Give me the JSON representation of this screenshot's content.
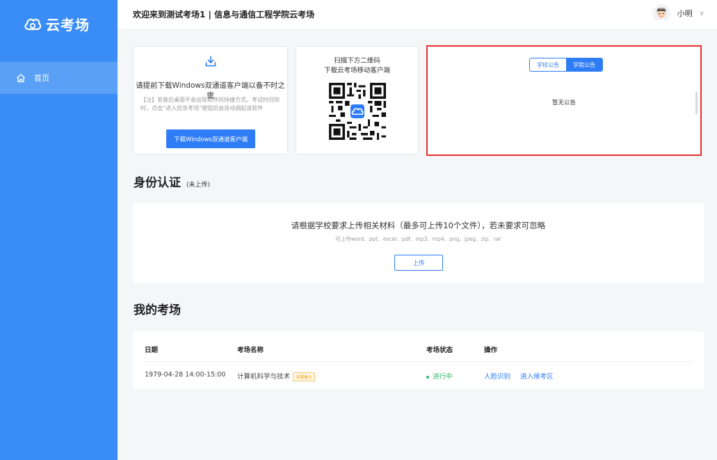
{
  "app": {
    "logo_text": "云考场",
    "colors": {
      "sidebar": "#3a8df6",
      "primary": "#2f7df6",
      "success": "#2fb86a",
      "highlight_border": "#e3302e"
    }
  },
  "sidebar": {
    "items": [
      {
        "label": "首页",
        "icon": "home-icon"
      }
    ]
  },
  "header": {
    "title": "欢迎来到测试考场1 | 信息与通信工程学院云考场",
    "user_name": "小明"
  },
  "download_card": {
    "title": "请提前下载Windows双通道客户端以备不时之需",
    "note": "【注】安装后桌面不会出现软件的快捷方式。考试时间到时，点击“进入应急考场”按钮后会自动调起该软件",
    "button": "下载Windows双通道客户端"
  },
  "qr_card": {
    "line1": "扫描下方二维码",
    "line2": "下载云考场移动客户端"
  },
  "notice_card": {
    "tabs": [
      {
        "label": "学校公告",
        "active": false
      },
      {
        "label": "学院公告",
        "active": true
      }
    ],
    "empty_text": "暂无公告"
  },
  "identity": {
    "title": "身份认证",
    "status": "(未上传)",
    "main_text": "请根据学校要求上传相关材料（最多可上传10个文件），若未要求可忽略",
    "sub_text": "可上传word、ppt、excel、pdf、mp3、mp4、png、jpeg、zip、rar",
    "upload_button": "上传"
  },
  "exams": {
    "title": "我的考场",
    "columns": {
      "date": "日期",
      "name": "考场名称",
      "status": "考场状态",
      "actions": "操作"
    },
    "rows": [
      {
        "date": "1979-04-28 14:00-15:00",
        "name": "计算机科学与技术",
        "badge": "对摄像头",
        "status": "进行中",
        "action_face": "人脸识别",
        "action_enter": "进入候考区"
      }
    ]
  }
}
